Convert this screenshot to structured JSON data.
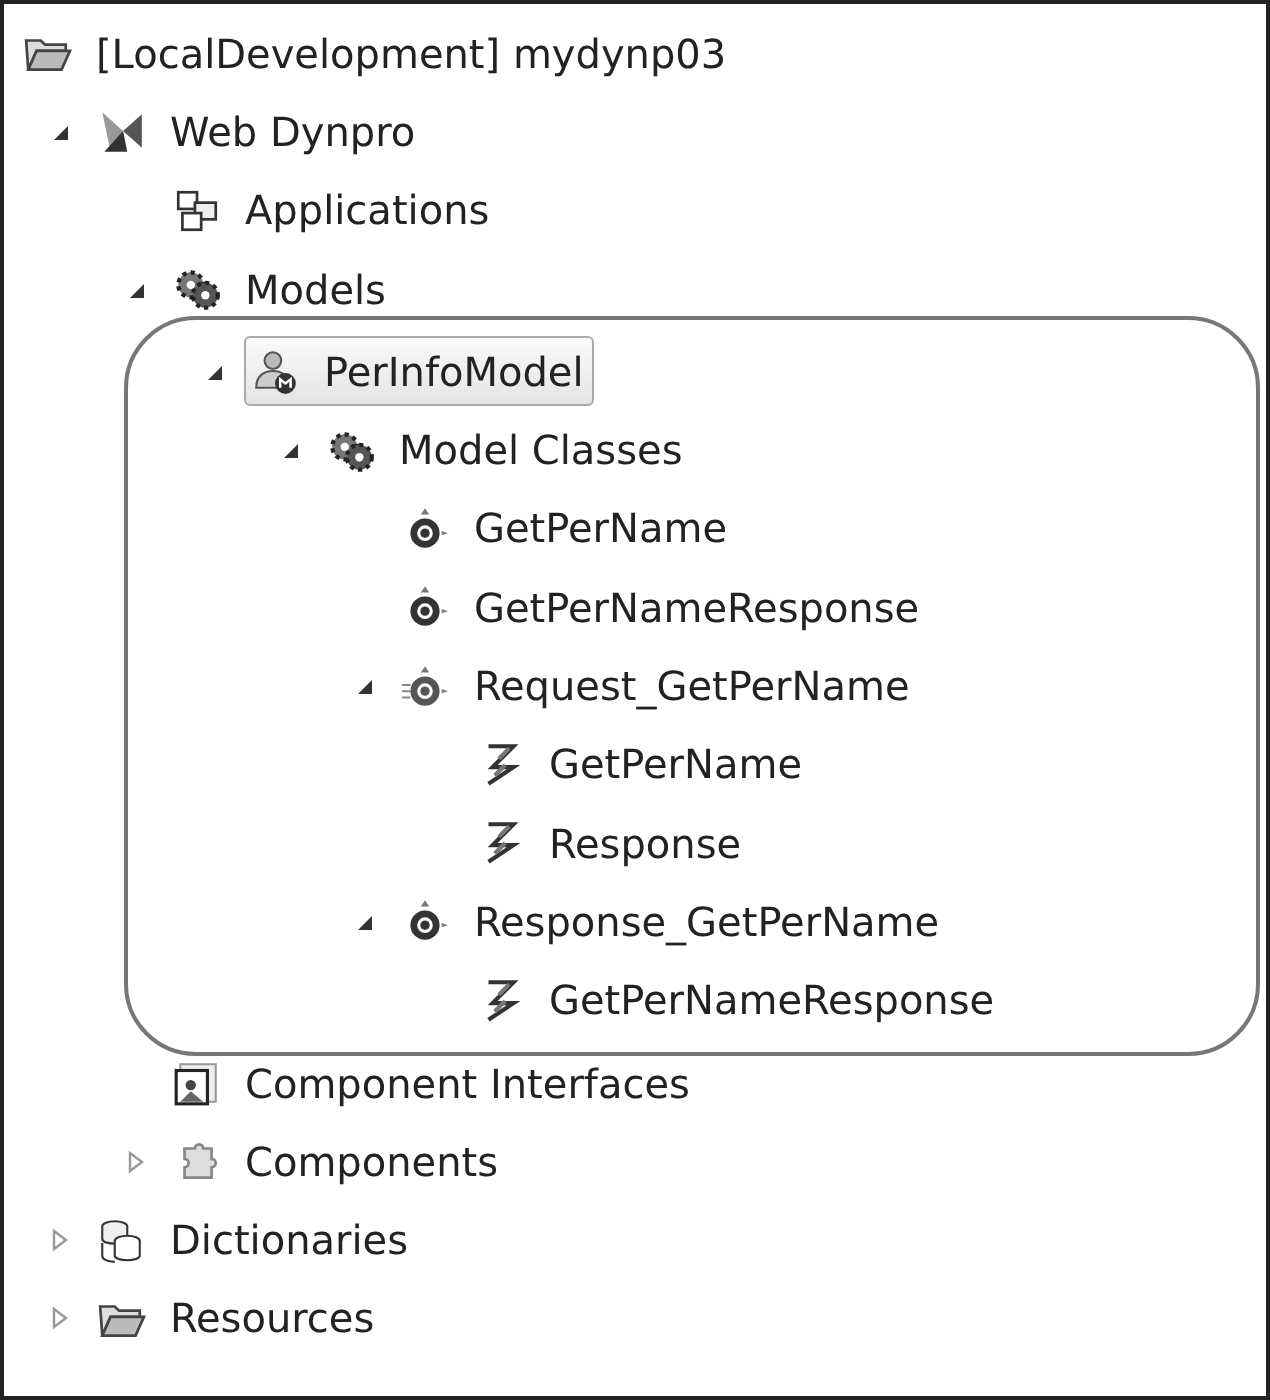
{
  "project": {
    "title": "[LocalDevelopment] mydynp03",
    "kind": "folder",
    "children": [
      {
        "label": "Web Dynpro",
        "kind": "dynpro",
        "expanded": true,
        "selected": false,
        "children": [
          {
            "label": "Applications",
            "kind": "applications",
            "selected": false
          },
          {
            "label": "Models",
            "kind": "gears",
            "expanded": true,
            "selected": false,
            "children": [
              {
                "label": "PerInfoModel",
                "kind": "model",
                "expanded": true,
                "selected": true,
                "highlighted": true,
                "children": [
                  {
                    "label": "Model Classes",
                    "kind": "gears",
                    "expanded": true,
                    "selected": false,
                    "children": [
                      {
                        "label": "GetPerName",
                        "kind": "class",
                        "selected": false
                      },
                      {
                        "label": "GetPerNameResponse",
                        "kind": "class",
                        "selected": false
                      },
                      {
                        "label": "Request_GetPerName",
                        "kind": "classmulti",
                        "expanded": true,
                        "selected": false,
                        "children": [
                          {
                            "label": "GetPerName",
                            "kind": "relation",
                            "selected": false
                          },
                          {
                            "label": "Response",
                            "kind": "relation",
                            "selected": false
                          }
                        ]
                      },
                      {
                        "label": "Response_GetPerName",
                        "kind": "class",
                        "expanded": true,
                        "selected": false,
                        "children": [
                          {
                            "label": "GetPerNameResponse",
                            "kind": "relation",
                            "selected": false
                          }
                        ]
                      }
                    ]
                  }
                ]
              }
            ]
          },
          {
            "label": "Component Interfaces",
            "kind": "interfaces",
            "selected": false
          },
          {
            "label": "Components",
            "kind": "puzzle",
            "expanded": false,
            "selected": false
          }
        ]
      },
      {
        "label": "Dictionaries",
        "kind": "database",
        "expanded": false,
        "selected": false
      },
      {
        "label": "Resources",
        "kind": "folder",
        "expanded": false,
        "selected": false
      }
    ]
  }
}
